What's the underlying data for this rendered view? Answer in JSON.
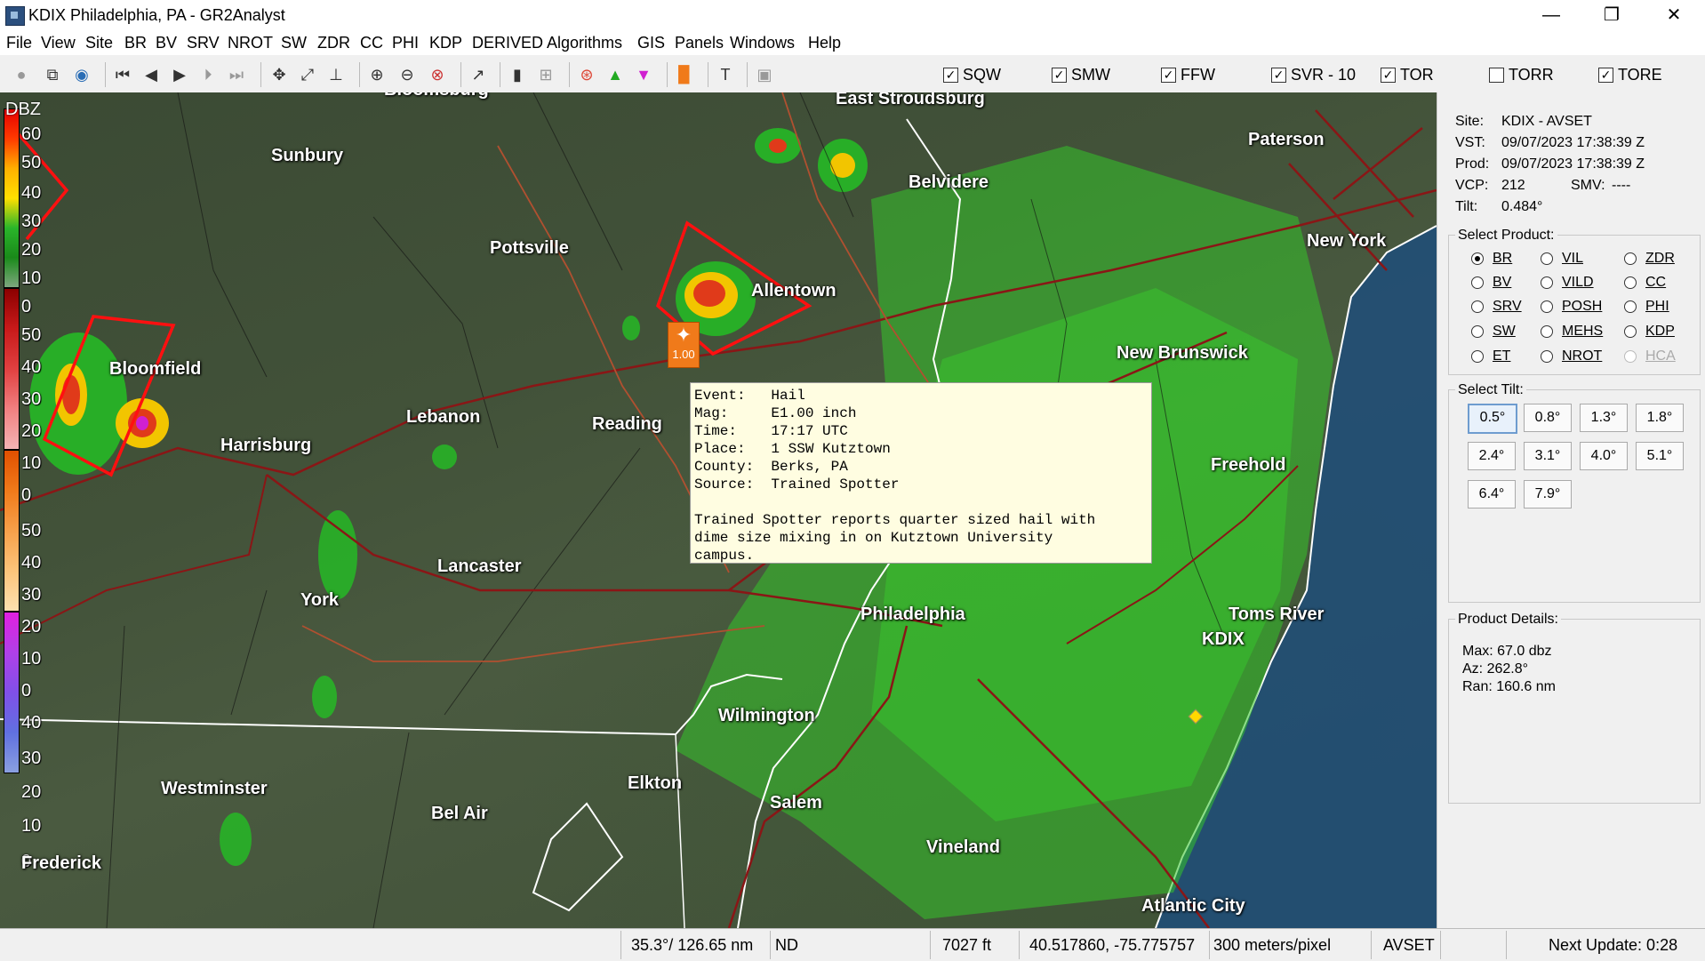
{
  "window": {
    "title": "KDIX Philadelphia, PA - GR2Analyst",
    "min": "—",
    "max": "❐",
    "close": "✕"
  },
  "menu": [
    "File",
    "View",
    "Site",
    "BR",
    "BV",
    "SRV",
    "NROT",
    "SW",
    "ZDR",
    "CC",
    "PHI",
    "KDP",
    "DERIVED",
    "Algorithms",
    "GIS",
    "Panels",
    "Windows",
    "Help"
  ],
  "warnings": [
    {
      "label": "SQW",
      "checked": true
    },
    {
      "label": "SMW",
      "checked": true
    },
    {
      "label": "FFW",
      "checked": true
    },
    {
      "label": "SVR - 10",
      "checked": true
    },
    {
      "label": "TOR",
      "checked": true
    },
    {
      "label": "TORR",
      "checked": false
    },
    {
      "label": "TORE",
      "checked": true
    }
  ],
  "map": {
    "scale_title": "DBZ",
    "scale_labels": [
      "60",
      "50",
      "40",
      "30",
      "20",
      "10",
      "0",
      "50",
      "40",
      "30",
      "20",
      "10",
      "0",
      "50",
      "40",
      "30",
      "20",
      "10",
      "0",
      "40",
      "30",
      "20",
      "10",
      "0"
    ],
    "cities": [
      "Bloomsburg",
      "East Stroudsburg",
      "Paterson",
      "Sunbury",
      "Belvidere",
      "New York",
      "Pottsville",
      "Allentown",
      "Bloomfield",
      "New Brunswick",
      "Lebanon",
      "Reading",
      "Harrisburg",
      "Freehold",
      "Lancaster",
      "Philadelphia",
      "York",
      "Toms River",
      "KDIX",
      "Wilmington",
      "Westminster",
      "Elkton",
      "Salem",
      "Bel Air",
      "Vineland",
      "Frederick",
      "Atlantic City"
    ],
    "report_marker": "1.00",
    "popup": {
      "lines": [
        "Event:   Hail",
        "Mag:     E1.00 inch",
        "Time:    17:17 UTC",
        "Place:   1 SSW Kutztown",
        "County:  Berks, PA",
        "Source:  Trained Spotter",
        "",
        "Trained Spotter reports quarter sized hail with",
        "dime size mixing in on Kutztown University",
        "campus."
      ]
    }
  },
  "panel": {
    "site_label": "Site:",
    "site": "KDIX - AVSET",
    "vst_label": "VST:",
    "vst": "09/07/2023  17:38:39 Z",
    "prod_label": "Prod:",
    "prod": "09/07/2023  17:38:39 Z",
    "vcp_label": "VCP:",
    "vcp": "212",
    "smv_label": "SMV:",
    "smv": "----",
    "tilt_label": "Tilt:",
    "tilt": "0.484°",
    "select_product": "Select Product:",
    "products": [
      {
        "label": "BR",
        "selected": true,
        "enabled": true
      },
      {
        "label": "VIL",
        "selected": false,
        "enabled": true
      },
      {
        "label": "ZDR",
        "selected": false,
        "enabled": true
      },
      {
        "label": "BV",
        "selected": false,
        "enabled": true
      },
      {
        "label": "VILD",
        "selected": false,
        "enabled": true
      },
      {
        "label": "CC",
        "selected": false,
        "enabled": true
      },
      {
        "label": "SRV",
        "selected": false,
        "enabled": true
      },
      {
        "label": "POSH",
        "selected": false,
        "enabled": true
      },
      {
        "label": "PHI",
        "selected": false,
        "enabled": true
      },
      {
        "label": "SW",
        "selected": false,
        "enabled": true
      },
      {
        "label": "MEHS",
        "selected": false,
        "enabled": true
      },
      {
        "label": "KDP",
        "selected": false,
        "enabled": true
      },
      {
        "label": "ET",
        "selected": false,
        "enabled": true
      },
      {
        "label": "NROT",
        "selected": false,
        "enabled": true
      },
      {
        "label": "HCA",
        "selected": false,
        "enabled": false
      }
    ],
    "select_tilt": "Select Tilt:",
    "tilts": [
      {
        "label": "0.5°",
        "selected": true
      },
      {
        "label": "0.8°",
        "selected": false
      },
      {
        "label": "1.3°",
        "selected": false
      },
      {
        "label": "1.8°",
        "selected": false
      },
      {
        "label": "2.4°",
        "selected": false
      },
      {
        "label": "3.1°",
        "selected": false
      },
      {
        "label": "4.0°",
        "selected": false
      },
      {
        "label": "5.1°",
        "selected": false
      },
      {
        "label": "6.4°",
        "selected": false
      },
      {
        "label": "7.9°",
        "selected": false
      }
    ],
    "product_details": "Product Details:",
    "max": "Max:  67.0 dbz",
    "az": "Az:   262.8°",
    "ran": "Ran:  160.6 nm"
  },
  "status": {
    "azran": "35.3°/ 126.65 nm",
    "nd": "ND",
    "height": "7027 ft",
    "latlon": "40.517860, -75.775757",
    "resolution": "300 meters/pixel",
    "site": "AVSET",
    "next_update": "Next Update: 0:28"
  }
}
